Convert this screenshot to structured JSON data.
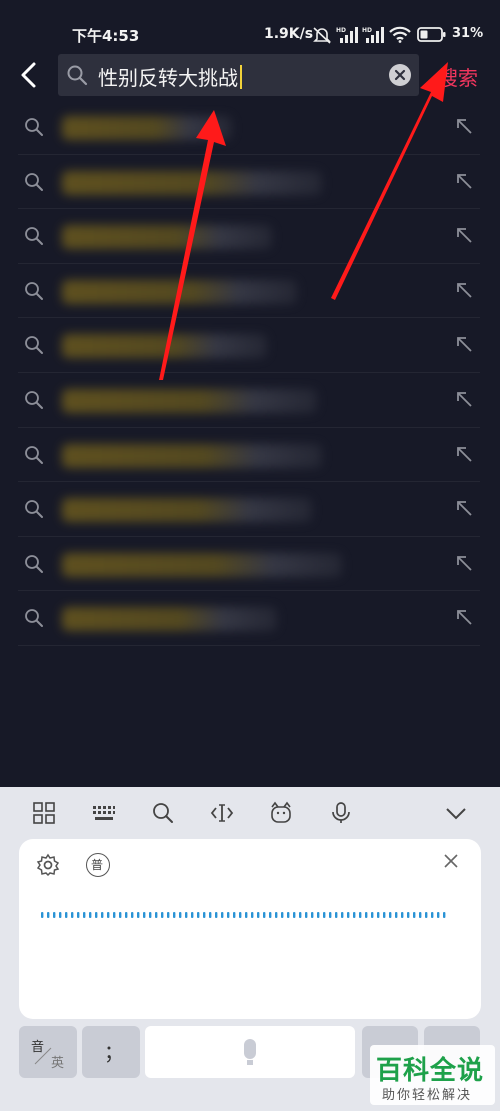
{
  "status_bar": {
    "time": "下午4:53",
    "net_speed": "1.9K/s",
    "battery": "31%"
  },
  "header": {
    "query": "性别反转大挑战",
    "search_button": "搜索"
  },
  "suggestions": {
    "count_hint": "10 blurred suggestion rows"
  },
  "keyboard": {
    "lang_top": "音",
    "lang_bottom": "英",
    "punct_key": "；",
    "mode_badge": "普"
  },
  "watermark": {
    "title": "百科全说",
    "subtitle": "助你轻松解决"
  },
  "colors": {
    "background": "#171927",
    "accent": "#f2365e",
    "annotation": "#ff1a1a",
    "wave": "#2a93d5"
  }
}
